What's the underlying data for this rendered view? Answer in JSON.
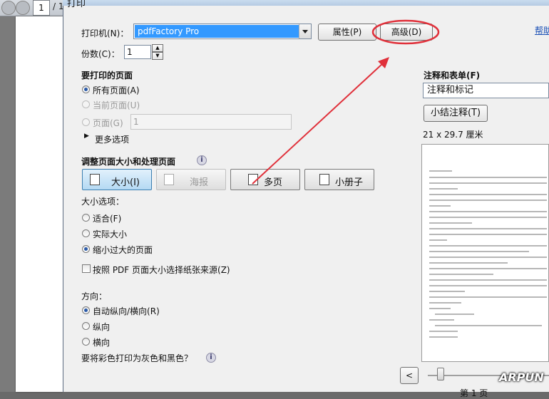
{
  "window": {
    "title": "打印"
  },
  "viewer": {
    "page": "1",
    "page_sep": "/ 1"
  },
  "printer": {
    "label": "打印机(N)：",
    "value": "pdfFactory Pro",
    "properties_label": "属性(P)",
    "advanced_label": "高级(D)",
    "help_label": "帮助"
  },
  "copies": {
    "label": "份数(C)：",
    "value": "1"
  },
  "pages": {
    "heading": "要打印的页面",
    "all": "所有页面(A)",
    "current": "当前页面(U)",
    "range": "页面(G)",
    "range_value": "1",
    "more": "更多选项"
  },
  "sizing": {
    "heading": "调整页面大小和处理页面",
    "buttons": {
      "size": "大小(I)",
      "poster": "海报",
      "multiple": "多页",
      "booklet": "小册子"
    },
    "options_label": "大小选项：",
    "fit": "适合(F)",
    "actual": "实际大小",
    "shrink": "缩小过大的页面",
    "choose_source": "按照 PDF 页面大小选择纸张来源(Z)"
  },
  "orientation": {
    "heading": "方向：",
    "auto": "自动纵向/横向(R)",
    "portrait": "纵向",
    "landscape": "横向"
  },
  "grayscale_label": "要将彩色打印为灰色和黑色？",
  "comments": {
    "heading": "注释和表单(F)",
    "value": "注释和标记",
    "summarize": "小结注释(T)",
    "page_size": "21 x 29.7 厘米"
  },
  "nav": {
    "prev": "<",
    "page_caption": "第 1 页"
  },
  "watermark": "ARPUN",
  "colors": {
    "accent": "#3399ff",
    "annotation": "#e0303a"
  }
}
